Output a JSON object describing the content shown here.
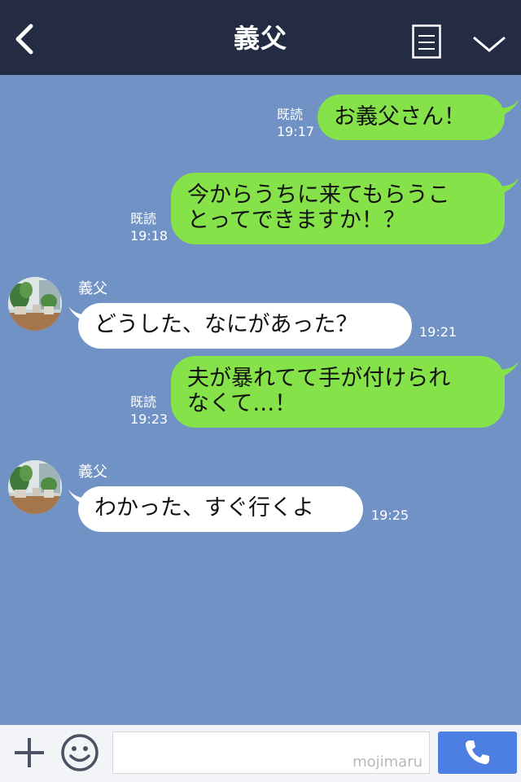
{
  "header": {
    "title": "義父"
  },
  "messages": [
    {
      "type": "sent",
      "read_label": "既読",
      "time": "19:17",
      "lines": [
        "お義父さん！"
      ]
    },
    {
      "type": "sent",
      "read_label": "既読",
      "time": "19:18",
      "lines": [
        "今からうちに来てもらうこ",
        "とってできますか！？"
      ]
    },
    {
      "type": "received",
      "sender": "義父",
      "time": "19:21",
      "lines": [
        "どうした、なにがあった？"
      ]
    },
    {
      "type": "sent",
      "read_label": "既読",
      "time": "19:23",
      "lines": [
        "夫が暴れてて手が付けられ",
        "なくて…！"
      ]
    },
    {
      "type": "received",
      "sender": "義父",
      "time": "19:25",
      "lines": [
        "わかった、すぐ行くよ"
      ]
    }
  ],
  "input": {
    "watermark": "mojimaru"
  },
  "colors": {
    "background": "#7192c4",
    "header": "#232c43",
    "sent_bubble": "#85e249",
    "received_bubble": "#ffffff",
    "call_button": "#4d7fe2"
  },
  "icons": [
    "back-icon",
    "memo-icon",
    "chevron-down-icon",
    "plus-icon",
    "emoji-icon",
    "phone-icon"
  ]
}
